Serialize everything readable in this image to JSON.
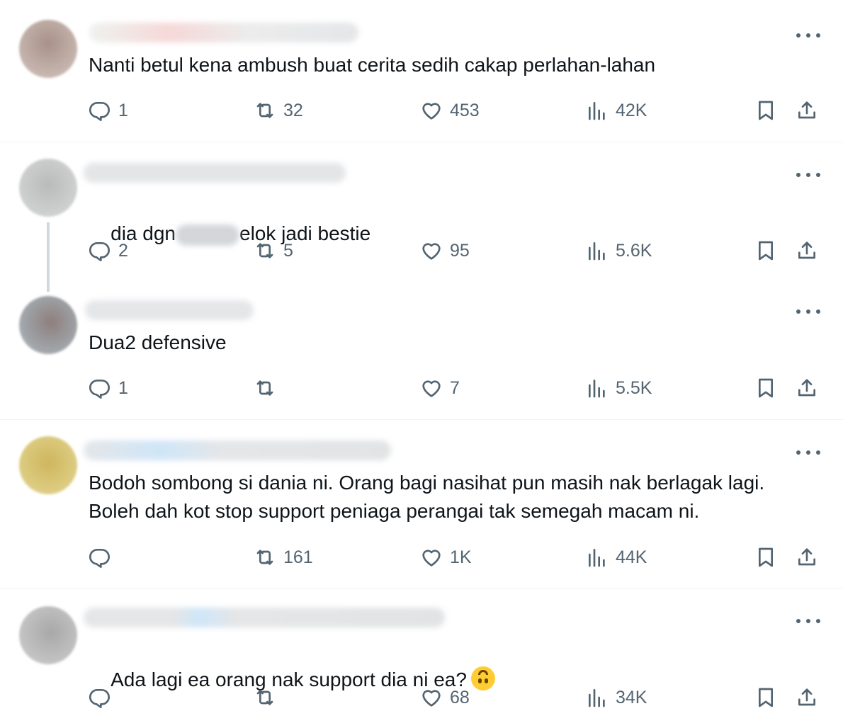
{
  "tweets": [
    {
      "text": "Nanti betul kena ambush buat cerita sedih cakap perlahan-lahan",
      "replies": "1",
      "retweets": "32",
      "likes": "453",
      "views": "42K"
    },
    {
      "text_before": "dia dgn",
      "text_after": "elok jadi bestie",
      "replies": "2",
      "retweets": "5",
      "likes": "95",
      "views": "5.6K"
    },
    {
      "text": "Dua2 defensive",
      "replies": "1",
      "retweets": "",
      "likes": "7",
      "views": "5.5K"
    },
    {
      "text": "Bodoh sombong si dania ni. Orang bagi nasihat pun masih nak berlagak lagi. Boleh dah kot stop support peniaga perangai tak semegah macam ni.",
      "replies": "",
      "retweets": "161",
      "likes": "1K",
      "views": "44K"
    },
    {
      "text": "Ada lagi ea orang nak support dia ni ea?",
      "emoji": "upside-down-face",
      "replies": "",
      "retweets": "",
      "likes": "68",
      "views": "34K"
    }
  ],
  "icons": {
    "reply": "reply-icon",
    "retweet": "retweet-icon",
    "like": "heart-icon",
    "views": "views-icon",
    "bookmark": "bookmark-icon",
    "share": "share-icon",
    "more": "more-icon"
  },
  "colors": {
    "muted": "#536471",
    "text": "#0f1419",
    "divider": "#eff3f4",
    "thread": "#cfd9de"
  }
}
